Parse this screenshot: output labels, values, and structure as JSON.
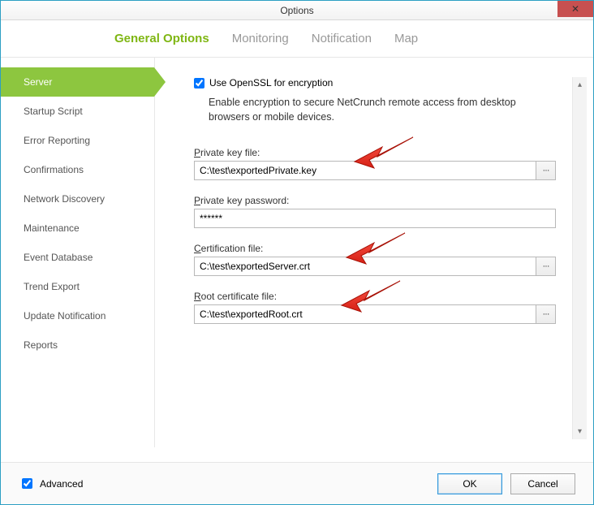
{
  "window_title": "Options",
  "tabs": [
    "General Options",
    "Monitoring",
    "Notification",
    "Map"
  ],
  "active_tab": 0,
  "sidebar": {
    "items": [
      "Server",
      "Startup Script",
      "Error Reporting",
      "Confirmations",
      "Network Discovery",
      "Maintenance",
      "Event Database",
      "Trend Export",
      "Update Notification",
      "Reports"
    ],
    "active_index": 0
  },
  "form": {
    "use_openssl_label": "Use OpenSSL for encryption",
    "use_openssl_checked": true,
    "description": "Enable encryption to secure NetCrunch remote access from desktop browsers or mobile devices.",
    "private_key_label_prefix": "P",
    "private_key_label_rest": "rivate key file:",
    "private_key_value": "C:\\test\\exportedPrivate.key",
    "private_key_pw_label_prefix": "P",
    "private_key_pw_label_rest": "rivate key password:",
    "private_key_pw_value": "******",
    "cert_label_prefix": "C",
    "cert_label_rest": "ertification file:",
    "cert_value": "C:\\test\\exportedServer.crt",
    "root_label_prefix": "R",
    "root_label_rest": "oot certificate file:",
    "root_value": "C:\\test\\exportedRoot.crt",
    "browse_glyph": "···"
  },
  "footer": {
    "advanced_label": "Advanced",
    "advanced_checked": true,
    "ok_label": "OK",
    "cancel_label": "Cancel"
  }
}
